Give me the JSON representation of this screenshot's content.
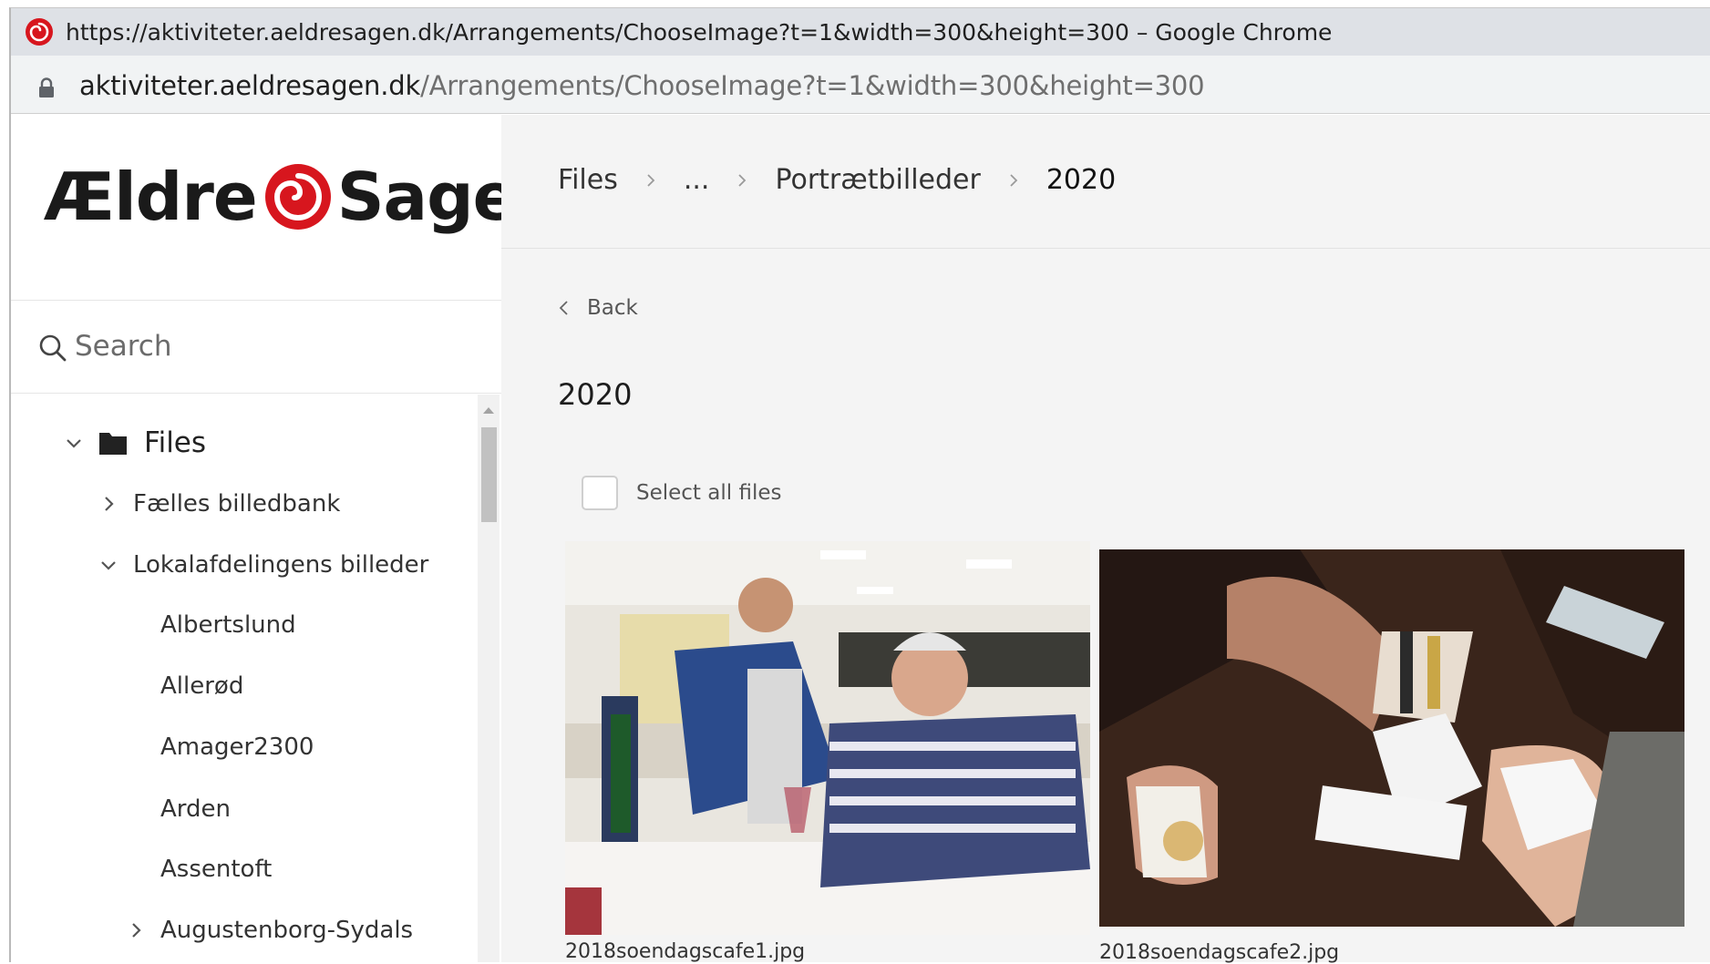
{
  "browser": {
    "window_title": "https://aktiviteter.aeldresagen.dk/Arrangements/ChooseImage?t=1&width=300&height=300 – Google Chrome",
    "url_host": "aktiviteter.aeldresagen.dk",
    "url_path": "/Arrangements/ChooseImage?t=1&width=300&height=300"
  },
  "sidebar": {
    "logo": {
      "text_left": "Ældre",
      "text_right": "Sagen",
      "brand_color": "#d7161e"
    },
    "search": {
      "placeholder": "Search"
    },
    "tree": {
      "root_label": "Files",
      "items": [
        {
          "label": "Fælles billedbank",
          "state": "collapsed"
        },
        {
          "label": "Lokalafdelingens billeder",
          "state": "expanded"
        },
        {
          "label": "Albertslund"
        },
        {
          "label": "Allerød"
        },
        {
          "label": "Amager2300"
        },
        {
          "label": "Arden"
        },
        {
          "label": "Assentoft"
        },
        {
          "label": "Augustenborg-Sydals",
          "state": "collapsed"
        }
      ]
    }
  },
  "main": {
    "breadcrumb": [
      "Files",
      "...",
      "Portrætbilleder",
      "2020"
    ],
    "back_label": "Back",
    "folder_title": "2020",
    "select_all_label": "Select all files",
    "files": [
      {
        "name": "2018soendagscafe1.jpg"
      },
      {
        "name": "2018soendagscafe2.jpg"
      }
    ]
  },
  "colors": {
    "titlebar": "#dee1e6",
    "addressbar": "#f1f3f4",
    "page_bg": "#f4f4f4",
    "brand_red": "#d7161e"
  }
}
